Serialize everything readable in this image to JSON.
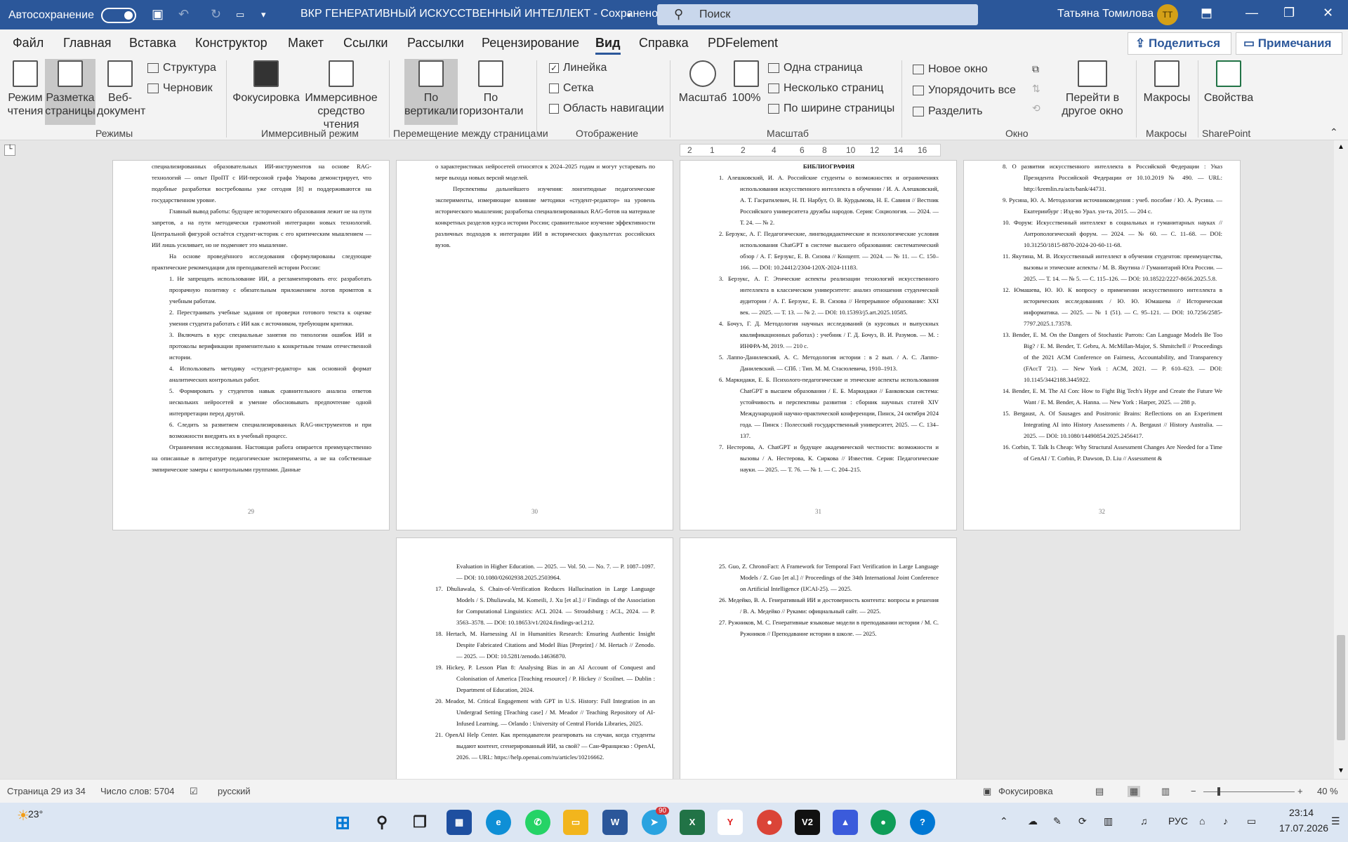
{
  "titlebar": {
    "autosave": "Автосохранение",
    "doc_title": "ВКР ГЕНЕРАТИВНЫЙ ИСКУССТВЕННЫЙ ИНТЕЛЛЕКТ  -  Сохранено",
    "search": "Поиск",
    "user": "Татьяна Томилова",
    "initials": "ТТ"
  },
  "menu": {
    "tabs": [
      "Файл",
      "Главная",
      "Вставка",
      "Конструктор",
      "Макет",
      "Ссылки",
      "Рассылки",
      "Рецензирование",
      "Вид",
      "Справка",
      "PDFelement"
    ],
    "share": "Поделиться",
    "notes": "Примечания"
  },
  "ribbon": {
    "read_mode": "Режим чтения",
    "page_layout": "Разметка страницы",
    "web": "Веб-документ",
    "structure": "Структура",
    "draft": "Черновик",
    "modes": "Режимы",
    "focus": "Фокусировка",
    "immersive": "Иммерсивное средство чтения",
    "immersive_group": "Иммерсивный режим",
    "vertical": "По вертикали",
    "horizontal": "По горизонтали",
    "page_move": "Перемещение между страницами",
    "ruler": "Линейка",
    "grid": "Сетка",
    "nav": "Область навигации",
    "show": "Отображение",
    "zoom": "Масштаб",
    "zoom100": "100%",
    "one_page": "Одна страница",
    "multi_page": "Несколько страниц",
    "page_width": "По ширине страницы",
    "zoom_group": "Масштаб",
    "new_window": "Новое окно",
    "arrange": "Упорядочить все",
    "split": "Разделить",
    "switch_window": "Перейти в другое окно",
    "window_group": "Окно",
    "macros": "Макросы",
    "macros_group": "Макросы",
    "props": "Свойства",
    "sharepoint": "SharePoint"
  },
  "ruler_ticks": [
    "2",
    "1",
    "2",
    "4",
    "6",
    "8",
    "10",
    "12",
    "14",
    "16"
  ],
  "pages": {
    "p29": {
      "num": "29",
      "paras": [
        "специализированных образовательных ИИ-инструментов на основе RAG-технологий — опыт ПроПТ с ИИ-персоной графа Уварова демонстрирует, что подобные разработки востребованы уже сегодня [8] и поддерживаются на государственном уровне.",
        "Главный вывод работы: будущее исторического образования лежит не на пути запретов, а на пути методически грамотной интеграции новых технологий. Центральной фигурой остаётся студент-историк с его критическим мышлением — ИИ лишь усиливает, но не подменяет это мышление.",
        "На основе проведённого исследования сформулированы следующие практические рекомендации для преподавателей истории России:"
      ],
      "items": [
        "1. Не запрещать использование ИИ, а регламентировать его: разработать прозрачную политику с обязательным приложением логов промптов к учебным работам.",
        "2. Перестраивать учебные задания от проверки готового текста к оценке умения студента работать с ИИ как с источником, требующим критики.",
        "3. Включать в курс специальные занятия по типологии ошибок ИИ и протоколы верификации применительно к конкретным темам отечественной истории.",
        "4. Использовать методику «студент-редактор» как основной формат аналитических контрольных работ.",
        "5. Формировать у студентов навык сравнительного анализа ответов нескольких нейросетей и умение обосновывать предпочтение одной интерпретации перед другой.",
        "6. Следить за развитием специализированных RAG-инструментов и при возможности внедрять их в учебный процесс."
      ],
      "tail": "Ограничения исследования. Настоящая работа опирается преимущественно на описанные в литературе педагогические эксперименты, а не на собственные эмпирические замеры с контрольными группами. Данные"
    },
    "p30": {
      "num": "30",
      "paras": [
        "о характеристиках нейросетей относятся к 2024–2025 годам и могут устаревать по мере выхода новых версий моделей.",
        "Перспективы дальнейшего изучения: лонгитюдные педагогические эксперименты, измеряющие влияние методики «студент-редактор» на уровень исторического мышления; разработка специализированных RAG-ботов на материале конкретных разделов курса истории России; сравнительное изучение эффективности различных подходов к интеграции ИИ в исторических факультетах российских вузов."
      ]
    },
    "p31": {
      "num": "31",
      "heading": "БИБЛИОГРАФИЯ",
      "items": [
        "1.  Алешковский, И. А. Российские студенты о возможностях и ограничениях использования искусственного интеллекта в обучении / И. А. Алешковский, А. Т. Гасратилевич, Н. П. Нарбут, О. В. Курдымова, Н. Е. Савиня // Вестник Российского университета дружбы народов. Серия: Социология. — 2024. — Т. 24. — № 2.",
        "2.  Берзукс, А. Г. Педагогические, лингводидактические и психологические условия использования ChatGPT в системе высшего образования: систематический обзор / А. Г. Берзукс, Е. В. Сизова // Концепт. — 2024. — № 11. — С. 150–166. — DOI: 10.24412/2304-120X-2024-11183.",
        "3.  Берзукс, А. Г. Этические аспекты реализации технологий искусственного интеллекта в классическом университете: анализ отношения студенческой аудитории / А. Г. Берзукс, Е. В. Сизова // Непрерывное образование: XXI век. — 2025. — Т. 13. — № 2. — DOI: 10.15393/j5.art.2025.10585.",
        "4.  Бочуз, Г. Д. Методология научных исследований (в курсовых и выпускных квалификационных работах) : учебник / Г. Д. Бочуз, В. И. Разумов. — М. : ИНФРА-М, 2019. — 210 с.",
        "5.  Лаппо-Данилевский, А. С. Методология истории : в 2 вып. / А. С. Лаппо-Данилевский. — СПб. : Тип. М. М. Стасюлевича, 1910–1913.",
        "6.  Маркидаки, Е. Б. Психолого-педагогические и этические аспекты использования ChatGPT в высшем образовании / Е. Б. Маркидаки // Банковская система: устойчивость и перспективы развития : сборник научных статей XIV Международной научно-практической конференции, Пинск, 24 октября 2024 года. — Пинск : Полесский государственный университет, 2025. — С. 134–137.",
        "7.  Нестерова, А. ChatGPT и будущее академической честности: возможности и вызовы / А. Нестерова, К. Сиркова // Известия. Серия: Педагогические науки. — 2025. — Т. 76. — № 1. — С. 204–215."
      ]
    },
    "p32": {
      "num": "32",
      "items": [
        "8.  О развитии искусственного интеллекта в Российской Федерации : Указ Президента Российской Федерации от 10.10.2019 № 490. — URL: http://kremlin.ru/acts/bank/44731.",
        "9.  Русина, Ю. А. Методология источниковедения : учеб. пособие / Ю. А. Русина. — Екатеринбург : Изд-во Урал. ун-та, 2015. — 204 с.",
        "10. Форум: Искусственный интеллект в социальных и гуманитарных науках // Антропологический форум. — 2024. — № 60. — С. 11–68. — DOI: 10.31250/1815-8870-2024-20-60-11-68.",
        "11. Якутина, М. В. Искусственный интеллект в обучении студентов: преимущества, вызовы и этические аспекты / М. В. Якутина // Гуманитарий Юга России. — 2025. — Т. 14. — № 5. — С. 115–126. — DOI: 10.18522/2227-8656.2025.5.8.",
        "12. Юмашева, Ю. Ю. К вопросу о применении искусственного интеллекта в исторических исследованиях / Ю. Ю. Юмашева // Историческая информатика. — 2025. — № 1 (51). — С. 95–121. — DOI: 10.7256/2585-7797.2025.1.73578.",
        "13. Bender, E. M. On the Dangers of Stochastic Parrots: Can Language Models Be Too Big? / E. M. Bender, T. Gebru, A. McMillan-Major, S. Shmitchell // Proceedings of the 2021 ACM Conference on Fairness, Accountability, and Transparency (FAccT '21). — New York : ACM, 2021. — P. 610–623. — DOI: 10.1145/3442188.3445922.",
        "14. Bender, E. M. The AI Con: How to Fight Big Tech's Hype and Create the Future We Want / E. M. Bender, A. Hanna. — New York : Harper, 2025. — 288 p.",
        "15. Bergaust, A. Of Sausages and Positronic Brains: Reflections on an Experiment Integrating AI into History Assessments / A. Bergaust // History Australia. — 2025. — DOI: 10.1080/14490854.2025.2456417.",
        "16. Corbin, T. Talk Is Cheap: Why Structural Assessment Changes Are Needed for a Time of GenAI / T. Corbin, P. Dawson, D. Liu // Assessment &"
      ]
    },
    "p33": {
      "items": [
        "Evaluation in Higher Education. — 2025. — Vol. 50. — No. 7. — P. 1087–1097. — DOI: 10.1080/02602938.2025.2503964.",
        "17. Dhuliawala, S. Chain-of-Verification Reduces Hallucination in Large Language Models / S. Dhuliawala, M. Komeili, J. Xu [et al.] // Findings of the Association for Computational Linguistics: ACL 2024. — Stroudsburg : ACL, 2024. — P. 3563–3578. — DOI: 10.18653/v1/2024.findings-acl.212.",
        "18. Hertach, M. Harnessing AI in Humanities Research: Ensuring Authentic Insight Despite Fabricated Citations and Model Bias [Preprint] / M. Hertach // Zenodo. — 2025. — DOI: 10.5281/zenodo.14636870.",
        "19. Hickey, P. Lesson Plan 8: Analysing Bias in an AI Account of Conquest and Colonisation of America [Teaching resource] / P. Hickey // Scoilnet. — Dublin : Department of Education, 2024.",
        "20. Meador, M. Critical Engagement with GPT in U.S. History: Full Integration in an Undergrad Setting [Teaching case] / M. Meador // Teaching Repository of AI-Infused Learning. — Orlando : University of Central Florida Libraries, 2025.",
        "21. OpenAI Help Center. Как преподаватели реагировать на случаи, когда студенты выдают контент, сгенерированный ИИ, за свой? — Сан-Франциско : OpenAI, 2026. — URL: https://help.openai.com/ru/articles/10216662."
      ]
    },
    "p34": {
      "items": [
        "25. Guo, Z. ChronoFact: A Framework for Temporal Fact Verification in Large Language Models / Z. Guo [et al.] // Proceedings of the 34th International Joint Conference on Artificial Intelligence (IJCAI-25). — 2025.",
        "26. Медейко, В. А. Генеративный ИИ и достоверность контента: вопросы и решения / В. А. Медейко // Руками: официальный сайт. — 2025.",
        "27. Ружников, М. С. Генеративные языковые модели в преподавании истории / М. С. Ружников // Преподавание истории в школе. — 2025."
      ]
    }
  },
  "status": {
    "page": "Страница 29 из 34",
    "words": "Число слов: 5704",
    "lang": "русский",
    "focus": "Фокусировка",
    "zoom": "40 %"
  },
  "taskbar": {
    "temp": "23°",
    "lang": "РУС",
    "time": "23:14",
    "date": "17.07.2026",
    "tg_badge": "90"
  }
}
